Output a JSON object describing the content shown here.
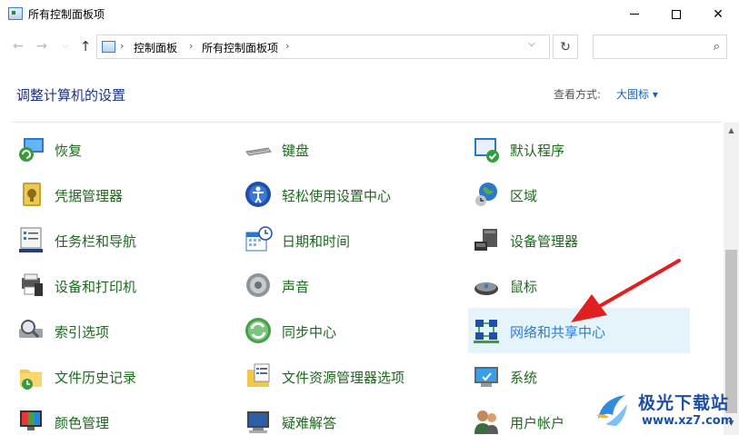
{
  "window": {
    "title": "所有控制面板项",
    "minimize": "",
    "maximize": "",
    "close": "✕"
  },
  "nav": {
    "back": "←",
    "forward": "→",
    "recent": "⌵",
    "up": "↑",
    "breadcrumbs": [
      "控制面板",
      "所有控制面板项"
    ],
    "separator": "›",
    "dropdown": "⌵",
    "refresh": "↻",
    "search_placeholder": "",
    "search_icon": "⌕"
  },
  "header": {
    "title": "调整计算机的设置",
    "view_label": "查看方式:",
    "view_value": "大图标 ▾"
  },
  "items": [
    {
      "label": "恢复",
      "icon": "recovery-icon"
    },
    {
      "label": "键盘",
      "icon": "keyboard-icon"
    },
    {
      "label": "默认程序",
      "icon": "default-programs-icon"
    },
    {
      "label": "凭据管理器",
      "icon": "credential-manager-icon"
    },
    {
      "label": "轻松使用设置中心",
      "icon": "ease-of-access-icon"
    },
    {
      "label": "区域",
      "icon": "region-icon"
    },
    {
      "label": "任务栏和导航",
      "icon": "taskbar-icon"
    },
    {
      "label": "日期和时间",
      "icon": "date-time-icon"
    },
    {
      "label": "设备管理器",
      "icon": "device-manager-icon"
    },
    {
      "label": "设备和打印机",
      "icon": "devices-printers-icon"
    },
    {
      "label": "声音",
      "icon": "sound-icon"
    },
    {
      "label": "鼠标",
      "icon": "mouse-icon"
    },
    {
      "label": "索引选项",
      "icon": "indexing-icon"
    },
    {
      "label": "同步中心",
      "icon": "sync-center-icon"
    },
    {
      "label": "网络和共享中心",
      "icon": "network-sharing-icon"
    },
    {
      "label": "文件历史记录",
      "icon": "file-history-icon"
    },
    {
      "label": "文件资源管理器选项",
      "icon": "explorer-options-icon"
    },
    {
      "label": "系统",
      "icon": "system-icon"
    },
    {
      "label": "颜色管理",
      "icon": "color-management-icon"
    },
    {
      "label": "疑难解答",
      "icon": "troubleshooting-icon"
    },
    {
      "label": "用户帐户",
      "icon": "user-accounts-icon"
    }
  ],
  "watermark": {
    "title": "极光下载站",
    "url": "www.xz7.com"
  },
  "colors": {
    "label": "#1d6a1d",
    "highlight_bg": "#e5f3fb",
    "title": "#1e3287",
    "arrow": "#e02020"
  }
}
